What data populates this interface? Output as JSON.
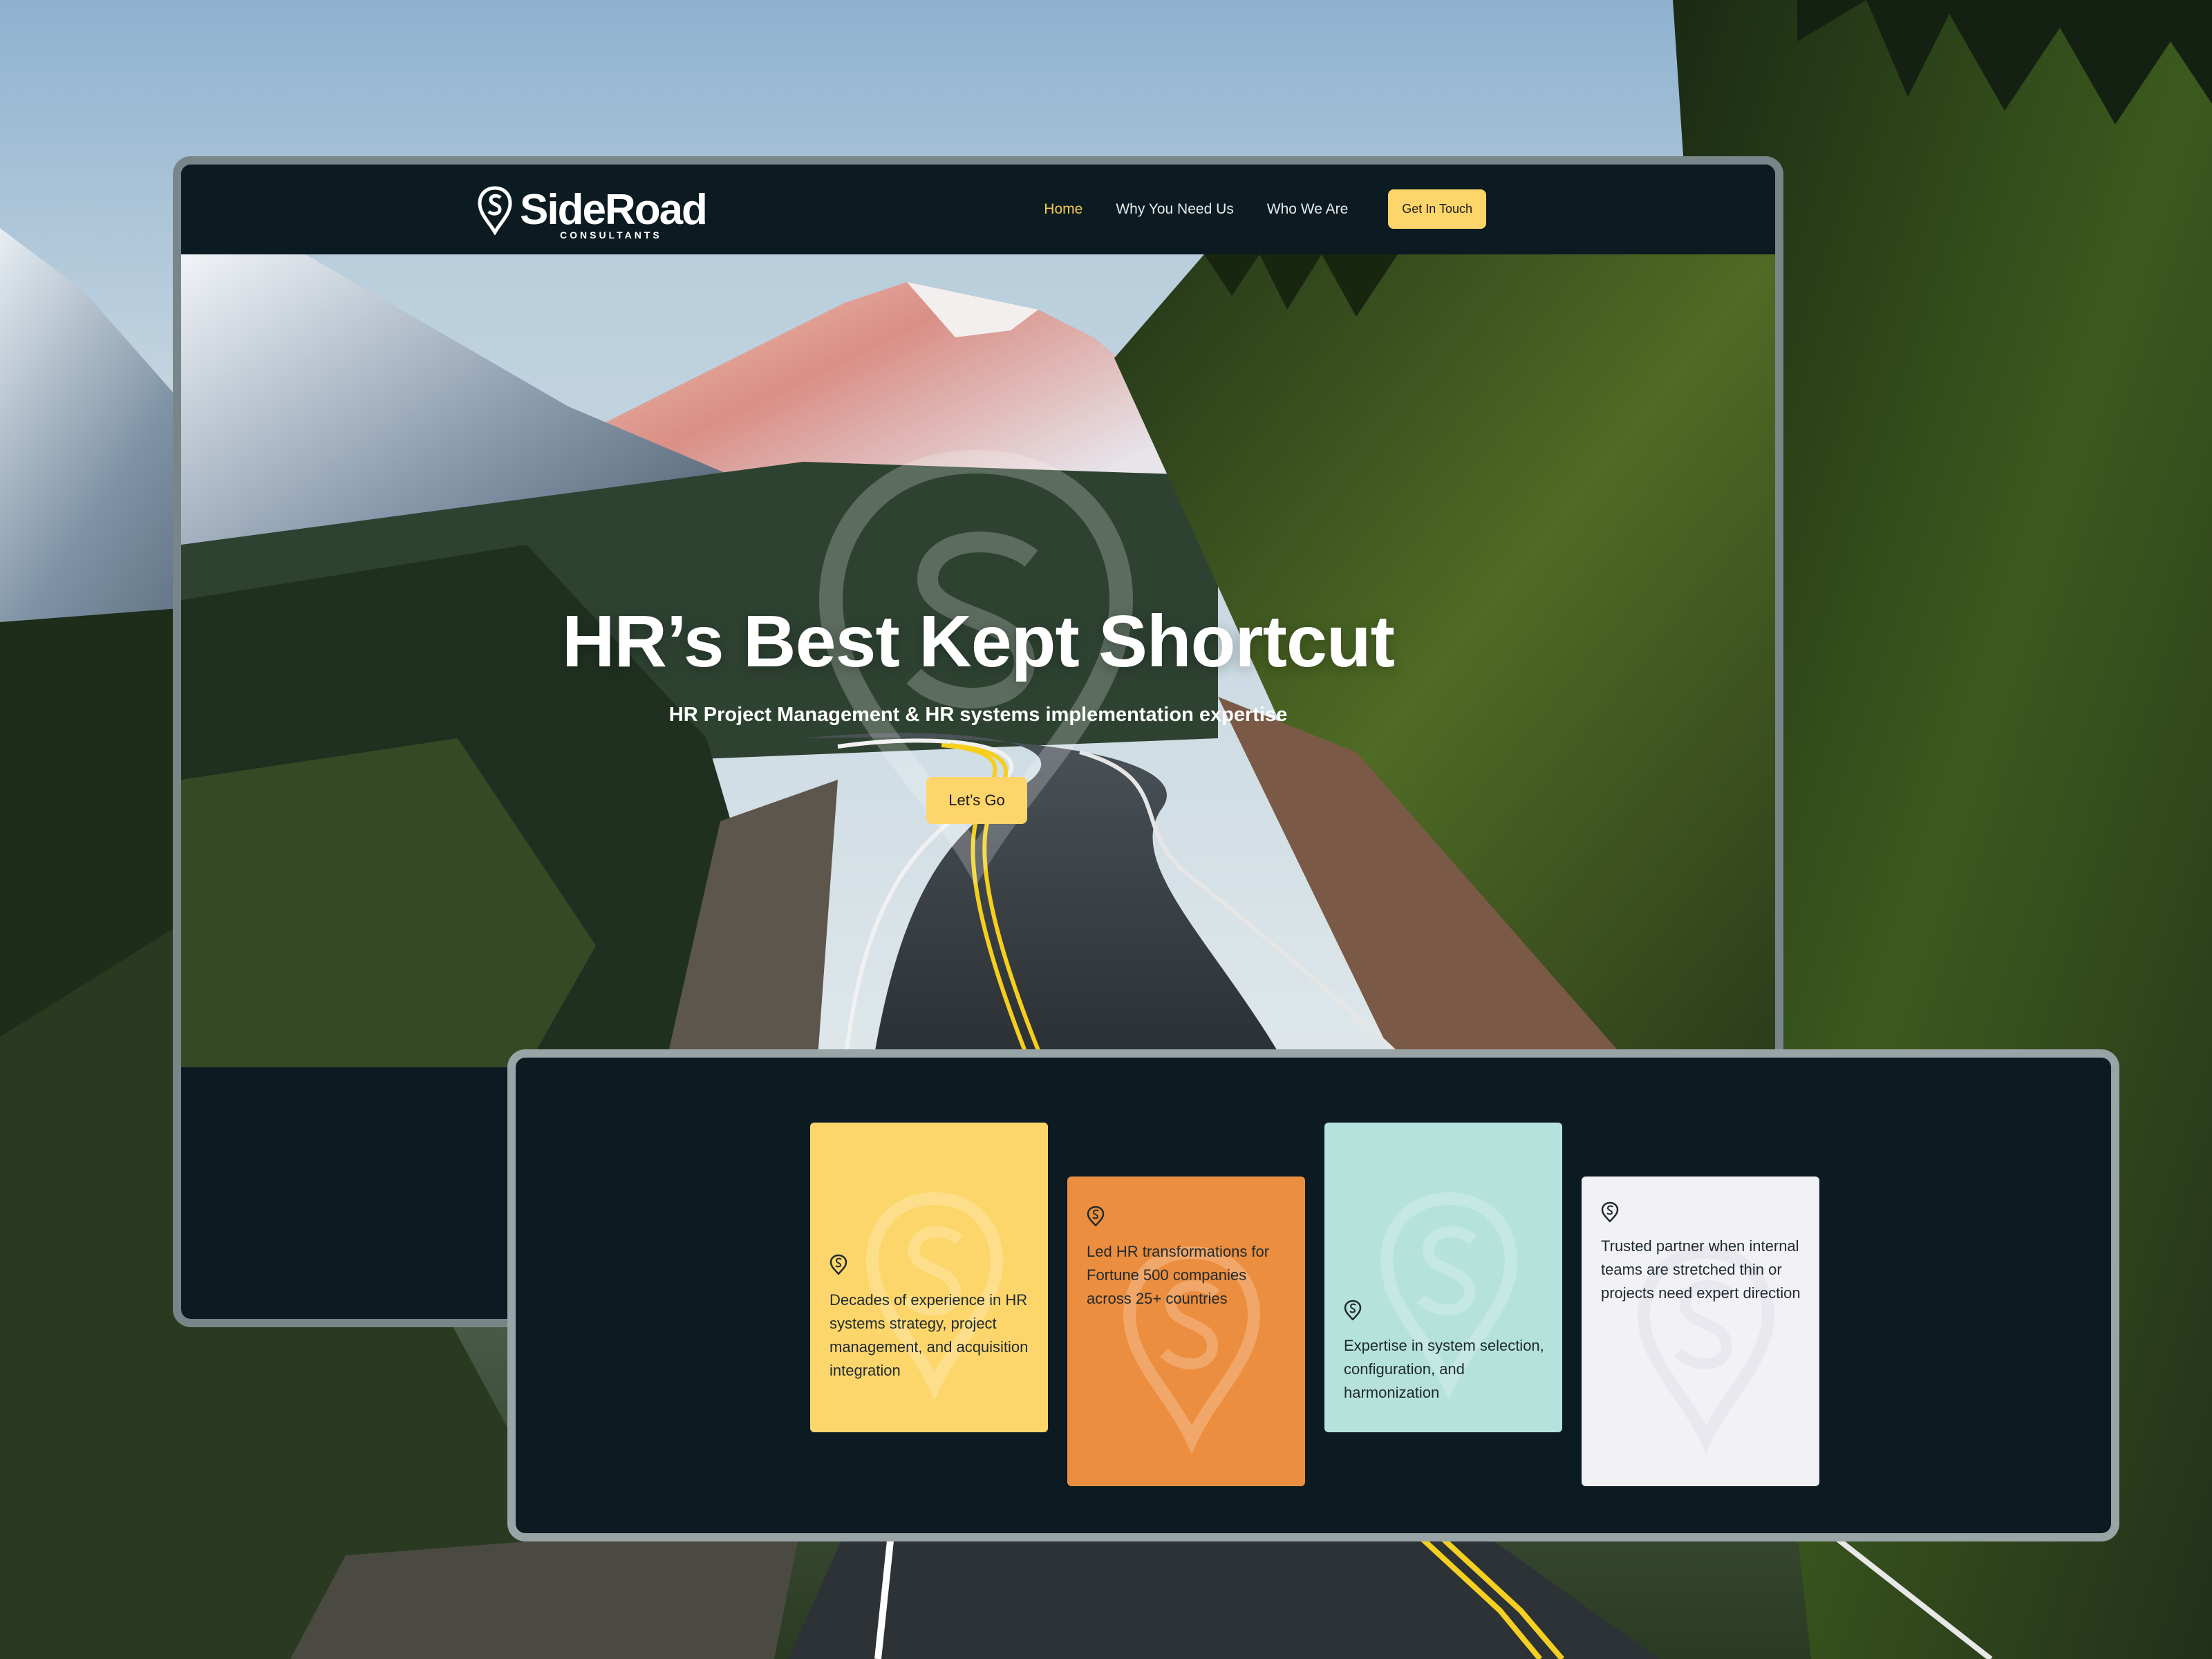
{
  "brand": {
    "name": "SideRoad",
    "tagline": "CONSULTANTS"
  },
  "nav": {
    "items": [
      {
        "label": "Home",
        "active": true
      },
      {
        "label": "Why You Need Us",
        "active": false
      },
      {
        "label": "Who We Are",
        "active": false
      }
    ],
    "cta_label": "Get In Touch"
  },
  "hero": {
    "title": "HR’s Best Kept Shortcut",
    "subtitle": "HR Project Management & HR systems implementation expertise",
    "button_label": "Let’s Go"
  },
  "cards": [
    {
      "text": "Decades of experience in HR systems strategy, project management, and acquisition integration",
      "color": "#fdd66b"
    },
    {
      "text": "Led HR transformations for Fortune 500 companies across 25+ countries",
      "color": "#ec8e3f"
    },
    {
      "text": "Expertise in system selection, configuration, and harmonization",
      "color": "#b6e2dc"
    },
    {
      "text": "Trusted partner when internal teams are stretched thin or projects need expert direction",
      "color": "#f1f1f6"
    }
  ],
  "colors": {
    "navy": "#0b1b21",
    "accent_yellow": "#fdd56a",
    "active_link": "#f7c94e"
  },
  "icons": [
    "location-pin-icon",
    "logo-pin-icon"
  ]
}
